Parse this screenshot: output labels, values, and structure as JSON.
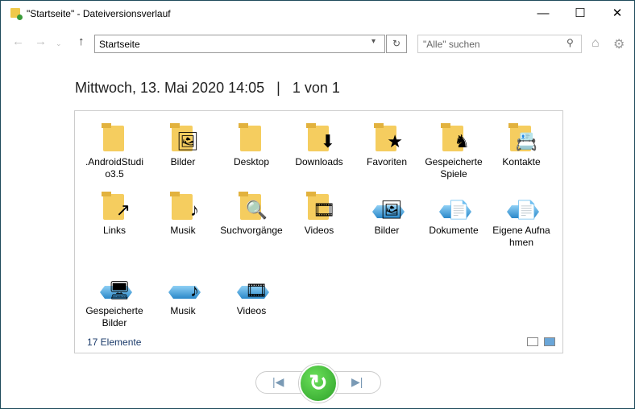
{
  "window": {
    "title": "\"Startseite\" - Dateiversionsverlauf"
  },
  "toolbar": {
    "address": "Startseite",
    "search_placeholder": "\"Alle\" suchen"
  },
  "header": {
    "date": "Mittwoch, 13. Mai 2020 14:05",
    "separator": "|",
    "position": "1 von 1"
  },
  "items": [
    {
      "label": ".AndroidStudio3.5",
      "kind": "folder",
      "overlay": ""
    },
    {
      "label": "Bilder",
      "kind": "folder",
      "overlay": "🖼"
    },
    {
      "label": "Desktop",
      "kind": "folder",
      "overlay": ""
    },
    {
      "label": "Downloads",
      "kind": "folder",
      "overlay": "⬇"
    },
    {
      "label": "Favoriten",
      "kind": "folder",
      "overlay": "★"
    },
    {
      "label": "Gespeicherte Spiele",
      "kind": "folder",
      "overlay": "♞"
    },
    {
      "label": "Kontakte",
      "kind": "folder",
      "overlay": "📇"
    },
    {
      "label": "Links",
      "kind": "folder",
      "overlay": "↗"
    },
    {
      "label": "Musik",
      "kind": "folder",
      "overlay": "♪"
    },
    {
      "label": "Suchvorgänge",
      "kind": "folder",
      "overlay": "🔍"
    },
    {
      "label": "Videos",
      "kind": "folder",
      "overlay": "🎞"
    },
    {
      "label": "Bilder",
      "kind": "library",
      "overlay": "🖼"
    },
    {
      "label": "Dokumente",
      "kind": "library",
      "overlay": "📄"
    },
    {
      "label": "Eigene Aufnahmen",
      "kind": "library",
      "overlay": "📄"
    },
    {
      "label": "Gespeicherte Bilder",
      "kind": "library",
      "overlay": "🖥"
    },
    {
      "label": "Musik",
      "kind": "library",
      "overlay": "♪"
    },
    {
      "label": "Videos",
      "kind": "library",
      "overlay": "🎞"
    }
  ],
  "status": {
    "count": "17 Elemente"
  },
  "colors": {
    "accent": "#2ea12a",
    "folder": "#f5cd5f"
  }
}
